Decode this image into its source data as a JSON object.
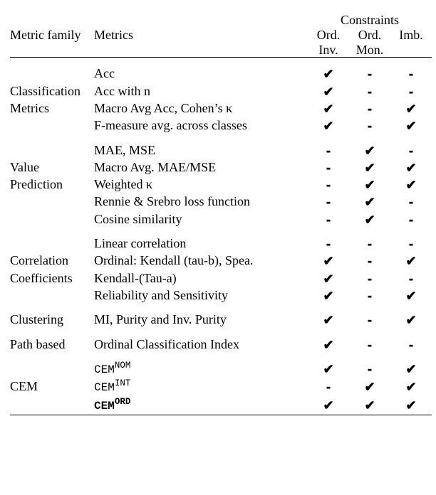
{
  "check": "✔",
  "dash": "-",
  "header": {
    "family": "Metric family",
    "metrics": "Metrics",
    "constraints": "Constraints",
    "c1a": "Ord.",
    "c1b": "Inv.",
    "c2a": "Ord.",
    "c2b": "Mon.",
    "c3a": "Imb.",
    "c3b": ""
  },
  "groups": [
    {
      "family_lines": [
        "Classification",
        "Metrics"
      ],
      "rows": [
        {
          "metric": "Acc",
          "c": [
            "✔",
            "-",
            "-"
          ]
        },
        {
          "metric": "Acc with n",
          "c": [
            "✔",
            "-",
            "-"
          ]
        },
        {
          "metric": "Macro Avg Acc, Cohen’s κ",
          "c": [
            "✔",
            "-",
            "✔"
          ]
        },
        {
          "metric": "F-measure avg. across classes",
          "c": [
            "✔",
            "-",
            "✔"
          ]
        }
      ]
    },
    {
      "family_lines": [
        "Value",
        "Prediction"
      ],
      "rows": [
        {
          "metric": "MAE, MSE",
          "c": [
            "-",
            "✔",
            "-"
          ]
        },
        {
          "metric": "Macro Avg. MAE/MSE",
          "c": [
            "-",
            "✔",
            "✔"
          ]
        },
        {
          "metric": "Weighted κ",
          "c": [
            "-",
            "✔",
            "✔"
          ]
        },
        {
          "metric": "Rennie & Srebro loss function",
          "c": [
            "-",
            "✔",
            "-"
          ]
        },
        {
          "metric": "Cosine similarity",
          "c": [
            "-",
            "✔",
            "-"
          ]
        }
      ]
    },
    {
      "family_lines": [
        "Correlation",
        "Coefficients"
      ],
      "rows": [
        {
          "metric": "Linear correlation",
          "c": [
            "-",
            "-",
            "-"
          ]
        },
        {
          "metric": "Ordinal: Kendall (tau-b), Spea.",
          "c": [
            "✔",
            "-",
            "✔"
          ]
        },
        {
          "metric": "Kendall-(Tau-a)",
          "c": [
            "✔",
            "-",
            "-"
          ]
        },
        {
          "metric": "Reliability and Sensitivity",
          "c": [
            "✔",
            "-",
            "✔"
          ]
        }
      ]
    },
    {
      "family_lines": [
        "Clustering"
      ],
      "rows": [
        {
          "metric": "MI, Purity and Inv. Purity",
          "c": [
            "✔",
            "-",
            "✔"
          ]
        }
      ]
    },
    {
      "family_lines": [
        "Path based"
      ],
      "rows": [
        {
          "metric": "Ordinal Classification Index",
          "c": [
            "✔",
            "-",
            "-"
          ]
        }
      ]
    },
    {
      "family_lines": [
        "CEM"
      ],
      "rows": [
        {
          "metric_html": "cem-nom",
          "base": "CEM",
          "sup": "NOM",
          "bold": false,
          "c": [
            "✔",
            "-",
            "✔"
          ]
        },
        {
          "metric_html": "cem-int",
          "base": "CEM",
          "sup": "INT",
          "bold": false,
          "c": [
            "-",
            "✔",
            "✔"
          ]
        },
        {
          "metric_html": "cem-ord",
          "base": "CEM",
          "sup": "ORD",
          "bold": true,
          "c": [
            "✔",
            "✔",
            "✔"
          ]
        }
      ]
    }
  ],
  "chart_data": {
    "type": "table",
    "columns": [
      "Metric family",
      "Metrics",
      "Ord. Inv.",
      "Ord. Mon.",
      "Imb."
    ],
    "rows": [
      [
        "Classification Metrics",
        "Acc",
        true,
        false,
        false
      ],
      [
        "Classification Metrics",
        "Acc with n",
        true,
        false,
        false
      ],
      [
        "Classification Metrics",
        "Macro Avg Acc, Cohen’s κ",
        true,
        false,
        true
      ],
      [
        "Classification Metrics",
        "F-measure avg. across classes",
        true,
        false,
        true
      ],
      [
        "Value Prediction",
        "MAE, MSE",
        false,
        true,
        false
      ],
      [
        "Value Prediction",
        "Macro Avg. MAE/MSE",
        false,
        true,
        true
      ],
      [
        "Value Prediction",
        "Weighted κ",
        false,
        true,
        true
      ],
      [
        "Value Prediction",
        "Rennie & Srebro loss function",
        false,
        true,
        false
      ],
      [
        "Value Prediction",
        "Cosine similarity",
        false,
        true,
        false
      ],
      [
        "Correlation Coefficients",
        "Linear correlation",
        false,
        false,
        false
      ],
      [
        "Correlation Coefficients",
        "Ordinal: Kendall (tau-b), Spea.",
        true,
        false,
        true
      ],
      [
        "Correlation Coefficients",
        "Kendall-(Tau-a)",
        true,
        false,
        false
      ],
      [
        "Correlation Coefficients",
        "Reliability and Sensitivity",
        true,
        false,
        true
      ],
      [
        "Clustering",
        "MI, Purity and Inv. Purity",
        true,
        false,
        true
      ],
      [
        "Path based",
        "Ordinal Classification Index",
        true,
        false,
        false
      ],
      [
        "CEM",
        "CEM^NOM",
        true,
        false,
        true
      ],
      [
        "CEM",
        "CEM^INT",
        false,
        true,
        true
      ],
      [
        "CEM",
        "CEM^ORD",
        true,
        true,
        true
      ]
    ]
  }
}
